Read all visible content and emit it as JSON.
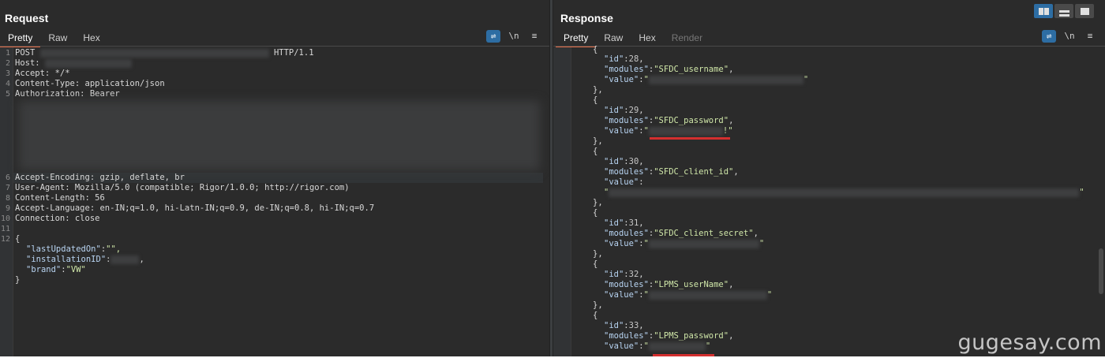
{
  "request": {
    "title": "Request",
    "tabs": [
      "Pretty",
      "Raw",
      "Hex"
    ],
    "active_tab": "Pretty",
    "icons": [
      "wrap-icon",
      "newline-icon",
      "menu-icon"
    ],
    "icon_text": {
      "newline": "\\n",
      "menu": "≡",
      "wrap": "⇌"
    },
    "lines": {
      "l1_method": "POST",
      "l1_version": "HTTP/1.1",
      "l2": "Host:",
      "l3": "Accept: */*",
      "l4": "Content-Type: application/json",
      "l5": "Authorization: Bearer",
      "l6": "Accept-Encoding: gzip, deflate, br",
      "l7": "User-Agent: Mozilla/5.0 (compatible; Rigor/1.0.0; http://rigor.com)",
      "l8": "Content-Length: 56",
      "l9": "Accept-Language: en-IN;q=1.0, hi-Latn-IN;q=0.9, de-IN;q=0.8, hi-IN;q=0.7",
      "l10": "Connection: close",
      "brace_open": "{",
      "brace_close": "}",
      "b1_key": "\"lastUpdatedOn\"",
      "b1_val": "\"\",",
      "b2_key": "\"installationID\"",
      "b3_key": "\"brand\"",
      "b3_val": "\"VW\""
    },
    "line_numbers": [
      "1",
      "2",
      "3",
      "4",
      "5",
      "6",
      "7",
      "8",
      "9",
      "10",
      "11",
      "12"
    ]
  },
  "response": {
    "title": "Response",
    "tabs": [
      "Pretty",
      "Raw",
      "Hex",
      "Render"
    ],
    "active_tab": "Pretty",
    "entries": [
      {
        "id": "28",
        "module": "\"SFDC_username\""
      },
      {
        "id": "29",
        "module": "\"SFDC_password\""
      },
      {
        "id": "30",
        "module": "\"SFDC_client_id\""
      },
      {
        "id": "31",
        "module": "\"SFDC_client_secret\""
      },
      {
        "id": "32",
        "module": "\"LPMS_userName\""
      },
      {
        "id": "33",
        "module": "\"LPMS_password\""
      }
    ],
    "labels": {
      "id_key": "\"id\"",
      "modules_key": "\"modules\"",
      "value_key": "\"value\"",
      "open": "{",
      "close": "},",
      "close_top": "},",
      "colon": ":",
      "quote": "\""
    }
  },
  "layout_buttons": [
    "split-horizontal-icon",
    "split-vertical-icon",
    "single-pane-icon"
  ],
  "watermark": "gugesay.com",
  "colors": {
    "accent": "#e8704a",
    "highlight": "#d32f2f",
    "blue": "#2d6da3"
  }
}
